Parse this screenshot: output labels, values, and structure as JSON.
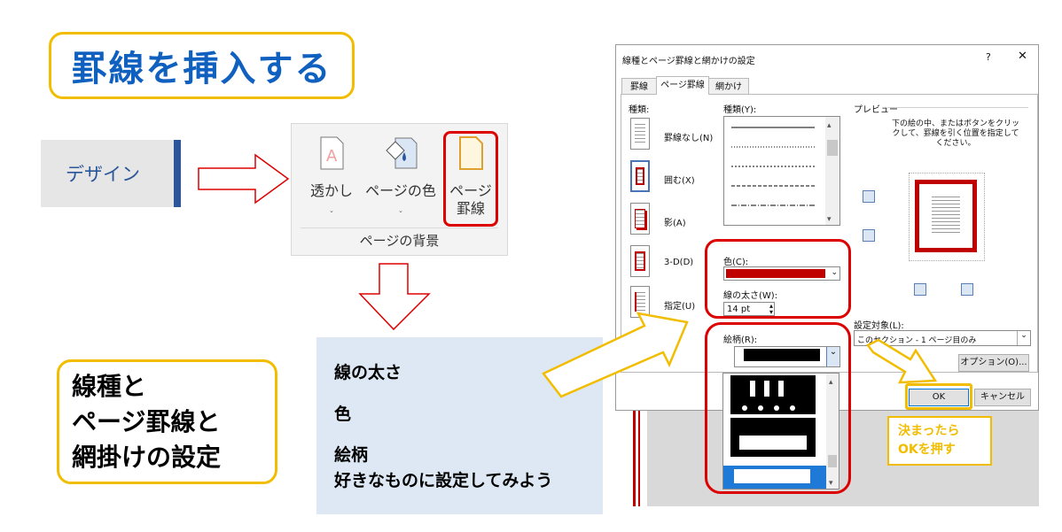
{
  "title": "罫線を挿入する",
  "ribbon_tab": {
    "label": "デザイン"
  },
  "ribbon": {
    "watermark_label": "透かし",
    "page_color_label": "ページの色",
    "page_borders_label": "ページ\n罫線",
    "group_label": "ページの背景",
    "dropdown_glyph": "ˇ"
  },
  "left_callout": {
    "text": "線種と\nページ罫線と\n網掛けの設定"
  },
  "info": {
    "line1": "線の太さ",
    "line2": "色",
    "line3": "絵柄",
    "line4": "好きなものに設定してみよう"
  },
  "dialog": {
    "title": "線種とページ罫線と網かけの設定",
    "help": "?",
    "close": "✕",
    "tabs": [
      "罫線",
      "ページ罫線",
      "網かけ"
    ],
    "settings_label": "種類:",
    "settings": [
      {
        "label": "罫線なし(N)"
      },
      {
        "label": "囲む(X)"
      },
      {
        "label": "影(A)"
      },
      {
        "label": "3-D(D)"
      },
      {
        "label": "指定(U)"
      }
    ],
    "style_label": "種類(Y):",
    "color_label": "色(C):",
    "color_value": "#c00000",
    "width_label": "線の太さ(W):",
    "width_value": "14 pt",
    "art_label": "絵柄(R):",
    "preview_label": "プレビュー",
    "preview_hint": "下の絵の中、またはボタンをクリックして、罫線を引く位置を指定してください。",
    "apply_label": "設定対象(L):",
    "apply_value": "このセクション - 1 ページ目のみ",
    "options_button": "オプション(O)...",
    "ok_button": "OK",
    "cancel_button": "キャンセル"
  },
  "note": {
    "text": "決まったら\nOKを押す"
  },
  "colors": {
    "accent_blue": "#1060c0",
    "highlight_red": "#dd0000",
    "callout_yellow": "#f2bd00",
    "word_blue": "#2b579a"
  }
}
